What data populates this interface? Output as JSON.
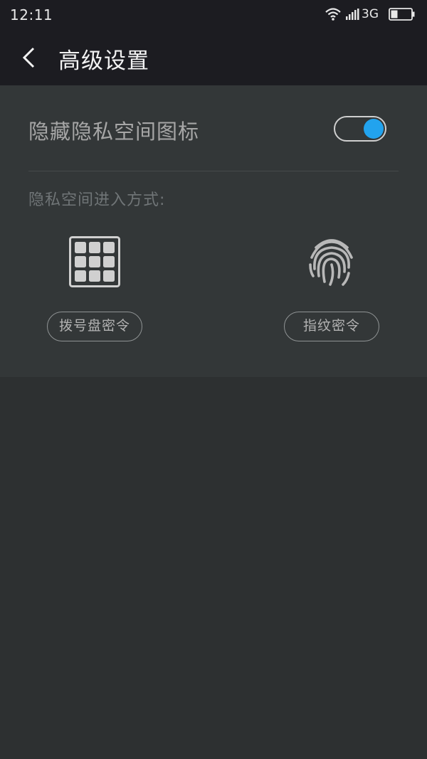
{
  "status_bar": {
    "time": "12:11",
    "network": "3G",
    "icons": [
      "wifi-icon",
      "signal-icon",
      "battery-icon"
    ]
  },
  "header": {
    "title": "高级设置",
    "back_icon": "chevron-left-icon"
  },
  "settings": {
    "hide_icon_label": "隐藏隐私空间图标",
    "hide_icon_enabled": true,
    "entry_methods_label": "隐私空间进入方式:",
    "methods": [
      {
        "label": "拨号盘密令",
        "icon": "dialpad-grid-icon"
      },
      {
        "label": "指纹密令",
        "icon": "fingerprint-icon"
      }
    ]
  },
  "colors": {
    "accent": "#22a3ee",
    "header_bg": "#1c1c21",
    "panel_bg": "#333738",
    "page_bg": "#2d3031"
  }
}
